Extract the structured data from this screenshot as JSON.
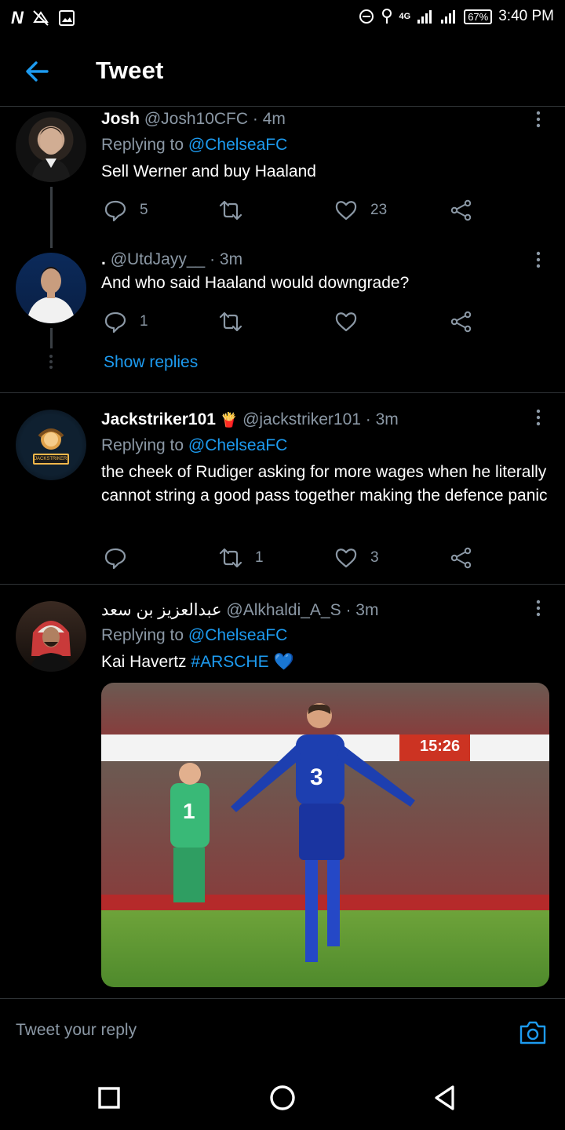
{
  "status_bar": {
    "time": "3:40 PM",
    "battery": "67%",
    "network": "4G"
  },
  "header": {
    "title": "Tweet"
  },
  "tweets": [
    {
      "name": "Josh",
      "handle": "@Josh10CFC",
      "time": "· 4m",
      "replying_label": "Replying to",
      "replying_to": "@ChelseaFC",
      "text": "Sell Werner and buy Haaland",
      "replies": "5",
      "retweets": "",
      "likes": "23"
    },
    {
      "name": ".",
      "handle": "@UtdJayy__",
      "time": "· 3m",
      "text": "And who said Haaland would downgrade?",
      "replies": "1",
      "retweets": "",
      "likes": "",
      "show_replies": "Show replies"
    },
    {
      "name": "Jackstriker101",
      "name_emoji": "🍟",
      "handle": "@jackstriker101",
      "time": "· 3m",
      "replying_label": "Replying to",
      "replying_to": "@ChelseaFC",
      "text": "the cheek of Rudiger asking for more wages when he literally cannot string a good pass together making the defence panic",
      "replies": "",
      "retweets": "1",
      "likes": "3",
      "avatar_text": "JACKSTRIKER101"
    },
    {
      "name": "عبدالعزيز بن سعد",
      "handle": "@Alkhaldi_A_S",
      "time": "· 3m",
      "replying_label": "Replying to",
      "replying_to": "@ChelseaFC",
      "text": "Kai Havertz",
      "hashtag": "#ARSCHE",
      "emoji": "💙",
      "media": {
        "scoreboard": "15:26",
        "shirt_number": "3",
        "keeper_number": "1"
      }
    }
  ],
  "reply_bar": {
    "placeholder": "Tweet your reply"
  },
  "colors": {
    "accent": "#1d9bf0",
    "muted": "#8b98a5",
    "divider": "#2f3336",
    "background": "#000000"
  },
  "icons": [
    "back-arrow-icon",
    "reply-icon",
    "retweet-icon",
    "like-icon",
    "share-icon",
    "more-icon",
    "camera-icon",
    "nav-recents-icon",
    "nav-home-icon",
    "nav-back-icon"
  ]
}
